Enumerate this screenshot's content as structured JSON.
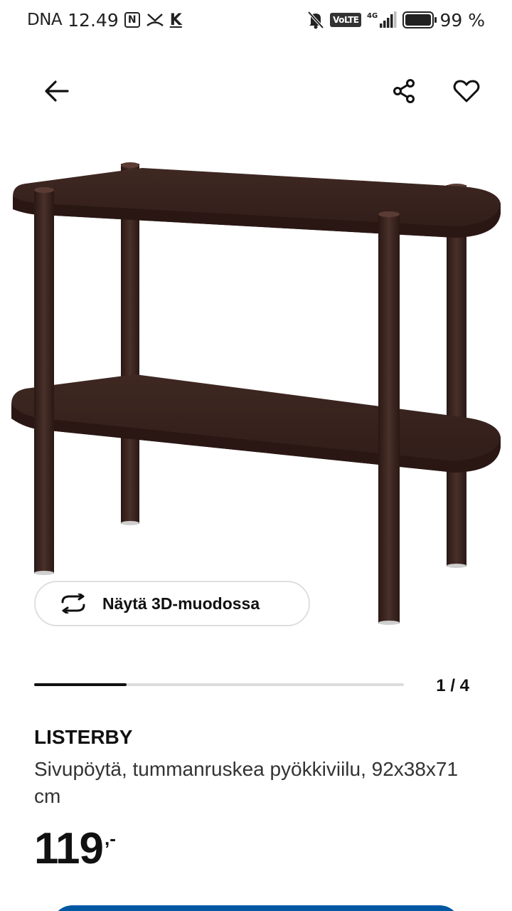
{
  "status_bar": {
    "carrier": "DNA",
    "time": "12.49",
    "nfc_label": "N",
    "k_label": "K",
    "volte_label": "VoLTE",
    "network_label": "4G",
    "battery_percent": "99 %",
    "battery_level": 0.99
  },
  "header": {
    "back_icon": "arrow-left-icon",
    "share_icon": "share-icon",
    "favorite_icon": "heart-icon"
  },
  "view_3d": {
    "label": "Näytä 3D-muodossa",
    "icon": "rotate-3d-icon"
  },
  "gallery": {
    "counter": "1 / 4",
    "current": 1,
    "total": 4
  },
  "product": {
    "name": "LISTERBY",
    "description": "Sivupöytä, tummanruskea pyökkiviilu, 92x38x71 cm",
    "price": "119",
    "price_suffix": ",-"
  },
  "colors": {
    "accent": "#0058a3",
    "wood": "#3b2520",
    "text": "#111111"
  }
}
